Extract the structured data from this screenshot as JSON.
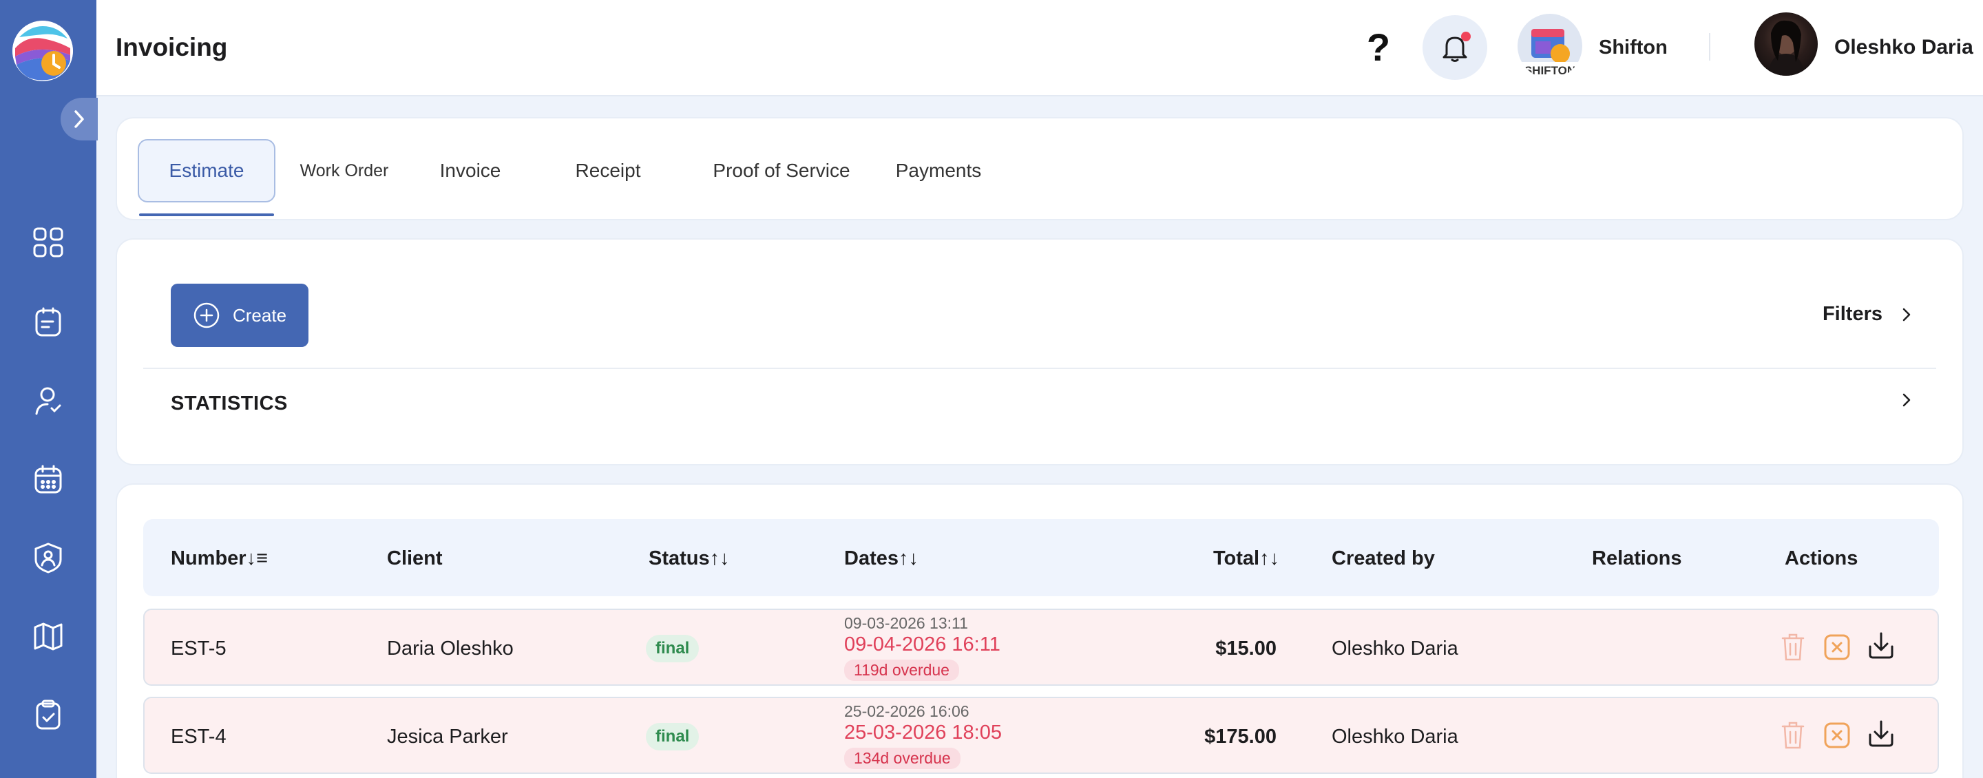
{
  "header": {
    "title": "Invoicing",
    "help_label": "?",
    "company_name": "Shifton",
    "user_name": "Oleshko Daria"
  },
  "sidebar": {
    "items": [
      {
        "icon": "dashboard-icon"
      },
      {
        "icon": "clipboard-list-icon"
      },
      {
        "icon": "user-refresh-icon"
      },
      {
        "icon": "calendar-icon"
      },
      {
        "icon": "badge-user-icon"
      },
      {
        "icon": "map-icon"
      },
      {
        "icon": "clipboard-check-icon"
      }
    ]
  },
  "tabs": [
    {
      "label": "Estimate",
      "active": true
    },
    {
      "label": "Work Order"
    },
    {
      "label": "Invoice"
    },
    {
      "label": "Receipt"
    },
    {
      "label": "Proof of Service"
    },
    {
      "label": "Payments"
    }
  ],
  "toolbar": {
    "create_label": "Create",
    "filters_label": "Filters"
  },
  "statistics": {
    "label": "STATISTICS"
  },
  "table": {
    "columns": {
      "number": "Number",
      "client": "Client",
      "status": "Status",
      "dates": "Dates",
      "total": "Total",
      "created_by": "Created by",
      "relations": "Relations",
      "actions": "Actions"
    },
    "rows": [
      {
        "number": "EST-5",
        "client": "Daria Oleshko",
        "status": "final",
        "created": "09-03-2026 13:11",
        "due": "09-04-2026 16:11",
        "overdue": "119d overdue",
        "total": "$15.00",
        "created_by": "Oleshko Daria"
      },
      {
        "number": "EST-4",
        "client": "Jesica Parker",
        "status": "final",
        "created": "25-02-2026 16:06",
        "due": "25-03-2026 18:05",
        "overdue": "134d overdue",
        "total": "$175.00",
        "created_by": "Oleshko Daria"
      }
    ]
  },
  "colors": {
    "sidebar": "#4467b3",
    "accent": "#4467b3",
    "danger": "#e0415a",
    "success": "#2e8b4e",
    "action_orange": "#f0a35a"
  }
}
